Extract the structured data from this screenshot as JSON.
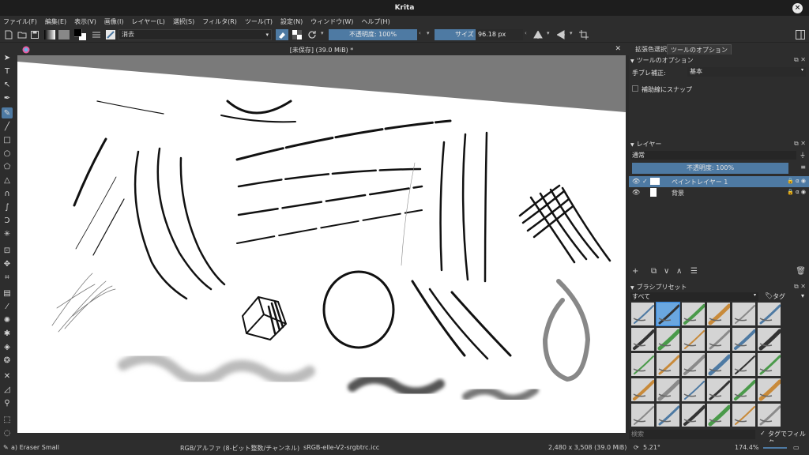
{
  "window": {
    "title": "Krita"
  },
  "menubar": [
    "ファイル(F)",
    "編集(E)",
    "表示(V)",
    "画像(I)",
    "レイヤー(L)",
    "選択(S)",
    "フィルタ(R)",
    "ツール(T)",
    "設定(N)",
    "ウィンドウ(W)",
    "ヘルプ(H)"
  ],
  "toolbar": {
    "blend_mode": "消去",
    "opacity_label": "不透明度: 100%",
    "opacity_value": 1.0,
    "size_label": "サイズ",
    "size_value": "96.18 px"
  },
  "document": {
    "tab_title": "[未保存]  (39.0 MiB) *"
  },
  "dock": {
    "tabs": [
      "拡張色選択",
      "ツールのオプション"
    ],
    "active_tab": 1,
    "tool_options": {
      "title": "ツールのオプション",
      "smoothing_label": "手ブレ補正:",
      "smoothing_value": "基本",
      "snap_label": "補助線にスナップ",
      "snap_checked": false
    },
    "layers": {
      "title": "レイヤー",
      "blend_mode": "通常",
      "opacity_label": "不透明度: 100%",
      "items": [
        {
          "name": "ペイントレイヤー 1",
          "selected": true
        },
        {
          "name": "背景",
          "selected": false
        }
      ]
    },
    "presets": {
      "title": "ブラシプリセット",
      "filter": "すべて",
      "tag_label": "タグ",
      "search_placeholder": "検索",
      "tag_filter_label": "タグでフィルタ",
      "tag_filter_checked": true
    }
  },
  "status": {
    "brush": "a) Eraser Small",
    "color_space": "RGB/アルファ (8-ビット整数/チャンネル)",
    "profile": "sRGB-elle-V2-srgbtrc.icc",
    "dimensions": "2,480 x 3,508 (39.0 MiB)",
    "rotation": "5.21°",
    "zoom": "174.4%"
  },
  "colors": {
    "accent": "#4e7aa3",
    "panel": "#2d2d2d",
    "titlebar": "#1d1d1d"
  }
}
